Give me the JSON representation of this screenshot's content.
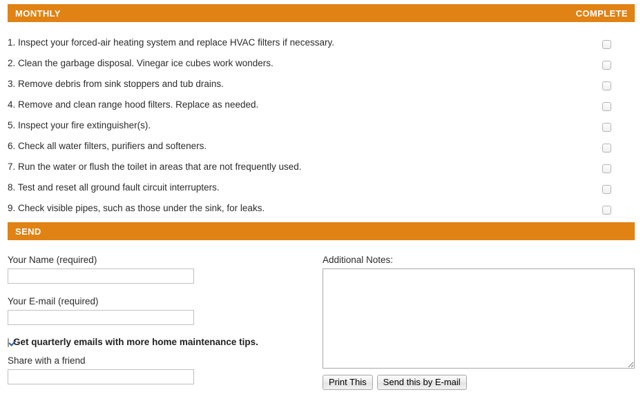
{
  "sections": {
    "monthly": {
      "title": "MONTHLY",
      "right_label": "COMPLETE"
    },
    "send": {
      "title": "SEND",
      "right_label": ""
    }
  },
  "checklist": {
    "items": [
      {
        "text": "1. Inspect your forced-air heating system and replace HVAC filters if necessary.",
        "checked": false
      },
      {
        "text": "2. Clean the garbage disposal. Vinegar ice cubes work wonders.",
        "checked": false
      },
      {
        "text": "3. Remove debris from sink stoppers and tub drains.",
        "checked": false
      },
      {
        "text": "4. Remove and clean range hood filters. Replace as needed.",
        "checked": false
      },
      {
        "text": "5. Inspect your fire extinguisher(s).",
        "checked": false
      },
      {
        "text": "6. Check all water filters, purifiers and softeners.",
        "checked": false
      },
      {
        "text": "7. Run the water or flush the toilet in areas that are not frequently used.",
        "checked": false
      },
      {
        "text": "8. Test and reset all ground fault circuit interrupters.",
        "checked": false
      },
      {
        "text": "9. Check visible pipes, such as those under the sink, for leaks.",
        "checked": false
      }
    ]
  },
  "form": {
    "name_label": "Your Name (required)",
    "name_value": "",
    "name_placeholder": "",
    "email_label": "Your E-mail (required)",
    "email_value": "",
    "email_placeholder": "",
    "optin_label": "Get quarterly emails with more home maintenance tips.",
    "optin_checked": true,
    "share_label": "Share with a friend",
    "share_value": "",
    "share_placeholder": "",
    "notes_label": "Additional Notes:",
    "notes_value": "",
    "notes_placeholder": "",
    "print_button": "Print This",
    "send_button": "Send this by E-mail"
  },
  "colors": {
    "accent_orange": "#e08214",
    "bar_text": "#ffffff",
    "body_text": "#2b2b2b",
    "check_blue": "#2c5aa0"
  }
}
